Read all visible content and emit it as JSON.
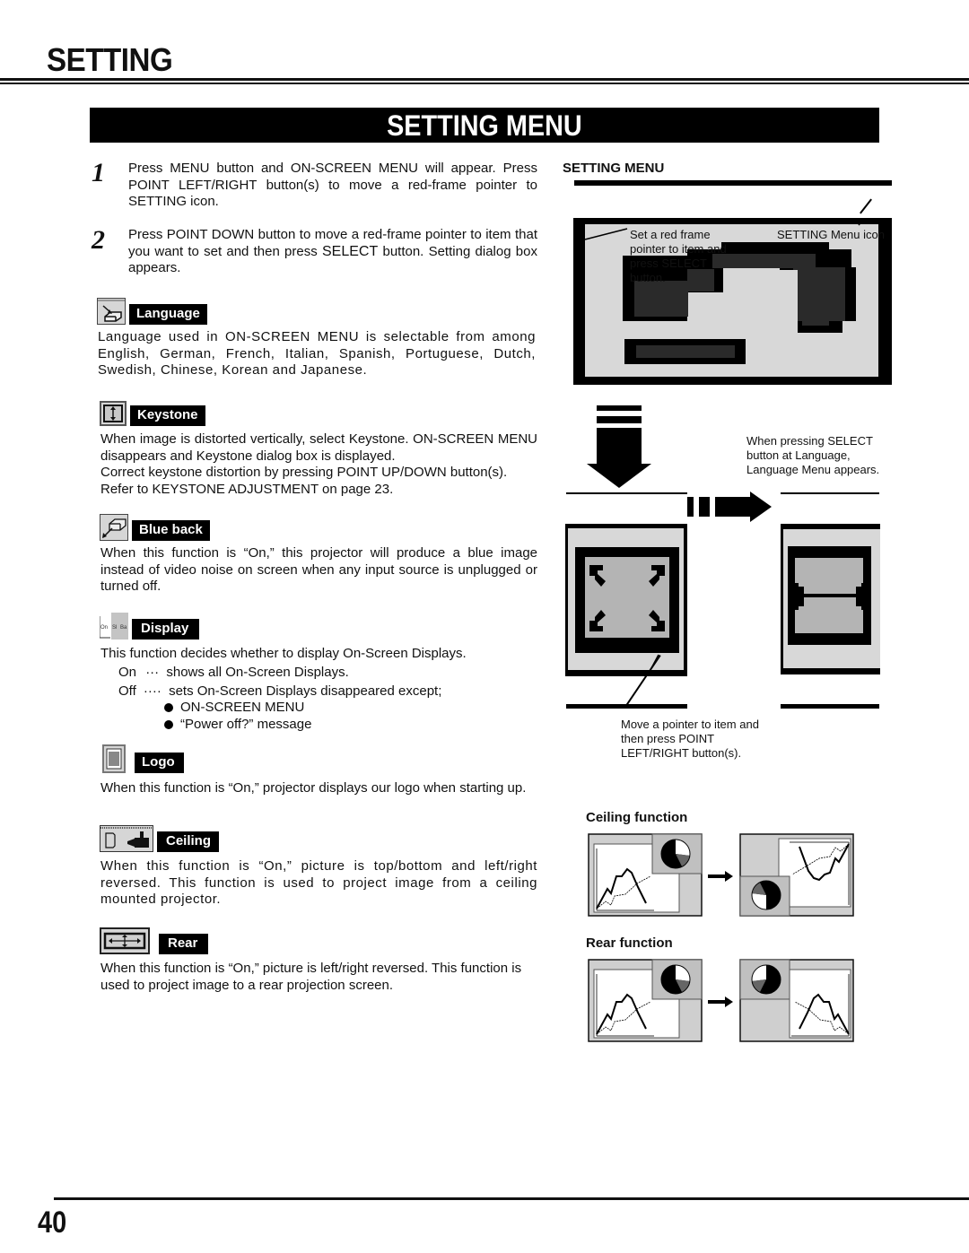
{
  "header": {
    "title": "SETTING",
    "section_banner": "SETTING MENU"
  },
  "steps": [
    {
      "number": "1",
      "text": "Press MENU button and ON-SCREEN MENU will appear.  Press POINT LEFT/RIGHT button(s) to move a red-frame pointer to SETTING icon."
    },
    {
      "number": "2",
      "text_a": "Press POINT DOWN button to move a red-frame pointer to item that you want to set and then press ",
      "text_select": "SELECT",
      "text_b": " button.  Setting dialog box appears."
    }
  ],
  "items": {
    "language": {
      "label": "Language",
      "icon": "language-icon",
      "text": "Language used in ON-SCREEN MENU is selectable from among English, German, French, Italian, Spanish, Portuguese, Dutch, Swedish, Chinese, Korean and Japanese."
    },
    "keystone": {
      "label": "Keystone",
      "icon": "keystone-icon",
      "text_1": "When image is distorted vertically, select Keystone.  ON-SCREEN MENU disappears and Keystone dialog box is displayed.",
      "text_2": "Correct keystone distortion by pressing POINT UP/DOWN button(s). Refer to KEYSTONE ADJUSTMENT on page 23."
    },
    "blue_back": {
      "label": "Blue back",
      "icon": "blue-back-icon",
      "text": "When this function is “On,” this projector will produce a blue image instead of video noise on screen when any input source is unplugged or turned off."
    },
    "display": {
      "label": "Display",
      "icon": "display-icon",
      "text": "This function decides whether to display On-Screen Displays.",
      "options": [
        {
          "key": "On",
          "sep": "···",
          "desc": "shows all On-Screen Displays."
        },
        {
          "key": "Off",
          "sep": "····",
          "desc": "sets On-Screen Displays disappeared except;"
        }
      ],
      "exceptions": [
        "ON-SCREEN MENU",
        "“Power off?” message"
      ]
    },
    "logo": {
      "label": "Logo",
      "icon": "logo-icon",
      "text": "When this function is “On,” projector displays our logo when starting up."
    },
    "ceiling": {
      "label": "Ceiling",
      "icon": "ceiling-icon",
      "text": "When this function is “On,” picture is top/bottom and left/right reversed. This function is used to project image from a ceiling mounted projector."
    },
    "rear": {
      "label": "Rear",
      "icon": "rear-icon",
      "text": "When this function is “On,” picture is left/right reversed.  This function is used to project image to a rear projection screen."
    }
  },
  "figure": {
    "title": "SETTING MENU",
    "callout_pointer": "Set a red frame pointer to item and press SELECT button.",
    "callout_icon": "SETTING Menu icon",
    "callout_select": "When pressing SELECT button at Language, Language Menu appears.",
    "callout_move": "Move a pointer to item and then press POINT LEFT/RIGHT button(s).",
    "ceiling_label": "Ceiling function",
    "rear_label": "Rear function"
  },
  "footer": {
    "page_number": "40"
  },
  "colors": {
    "ink": "#000000",
    "panel_gray": "#d8d8d8",
    "mid_gray": "#b4b4b4",
    "dark_gray": "#2a2a2a"
  }
}
